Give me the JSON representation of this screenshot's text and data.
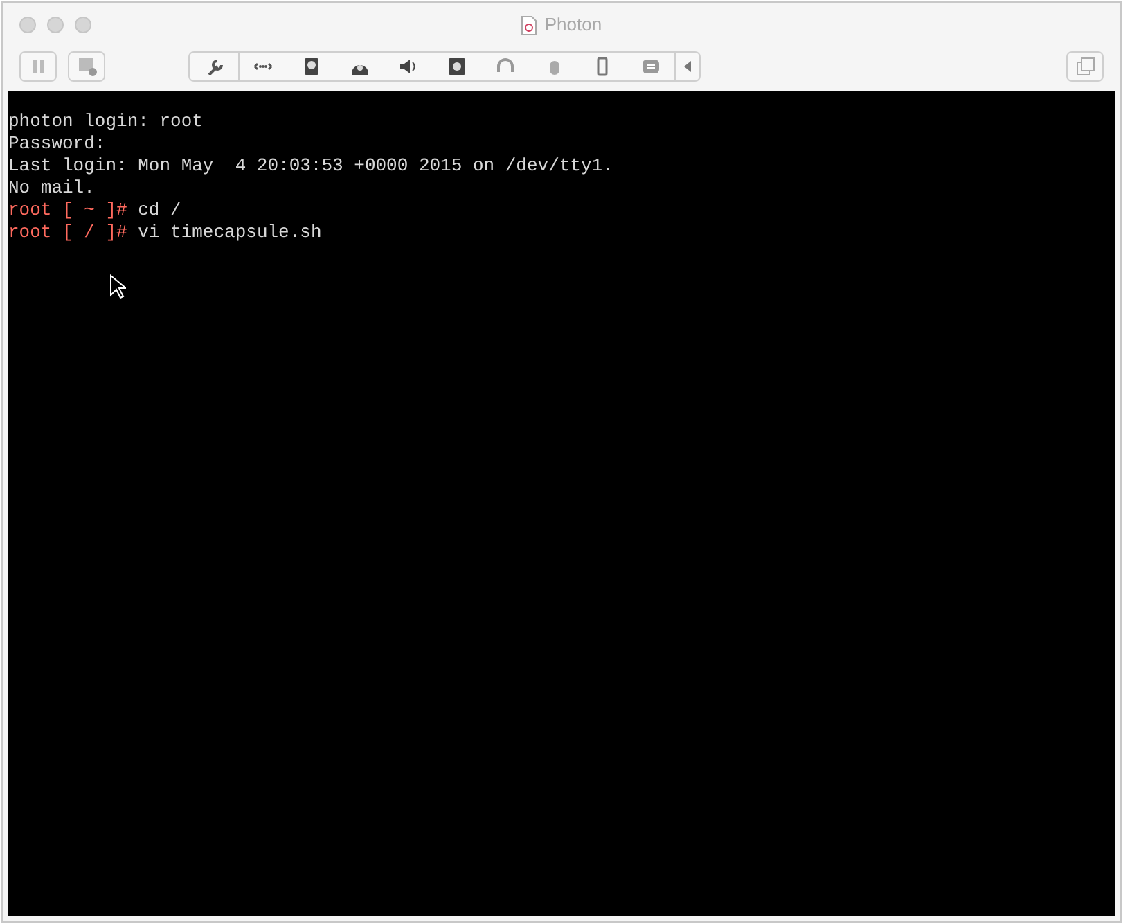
{
  "window": {
    "title": "Photon"
  },
  "terminal": {
    "lines": [
      {
        "text": "photon login: root"
      },
      {
        "text": "Password:"
      },
      {
        "text": "Last login: Mon May  4 20:03:53 +0000 2015 on /dev/tty1."
      },
      {
        "text": "No mail."
      },
      {
        "prompt": "root [ ~ ]#",
        "text": " cd /"
      },
      {
        "prompt": "root [ / ]#",
        "text": " vi timecapsule.sh"
      }
    ]
  }
}
